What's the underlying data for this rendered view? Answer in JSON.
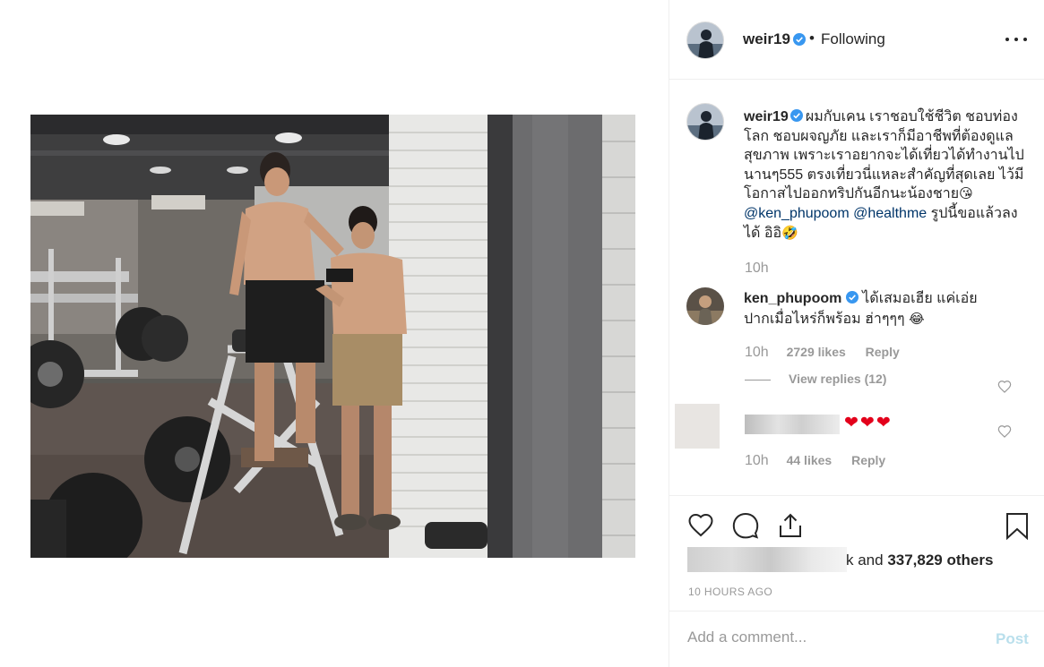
{
  "post": {
    "username": "weir19",
    "follow_status": "Following",
    "separator": "•",
    "photo_alt": ""
  },
  "caption": {
    "username": "weir19",
    "text_part1": "ผมกับเคน เราชอบใช้ชีวิต ชอบท่องโลก ชอบผจญภัย และเราก็มีอาชีพที่ต้องดูแลสุขภาพ เพราะเราอยากจะได้เที่ยวได้ทำงานไปนานๆ555 ตรงเที่ยวนี่แหละสำคัญที่สุดเลย ไว้มีโอกาสไปออกทริปกันอีกนะน้องชาย",
    "emoji1": "😘",
    "mention1": "@ken_phupoom",
    "mention2": "@healthme",
    "text_part2": "รูปนี้ขอแล้วลงได้ อิอิ",
    "emoji2": "🤣",
    "time": "10h"
  },
  "comments": [
    {
      "username": "ken_phupoom",
      "text": "ได้เสมอเฮีย แค่เอ่ยปากเมื่อไหร่ก็พร้อม ฮ่าๆๆๆ",
      "emoji": "😂",
      "time": "10h",
      "likes": "2729 likes",
      "reply_label": "Reply",
      "view_replies": "View replies (12)"
    },
    {
      "text": "❤❤❤",
      "time": "10h",
      "likes": "44 likes",
      "reply_label": "Reply"
    }
  ],
  "likes_summary": {
    "prefix": "k and ",
    "count": "337,829 others"
  },
  "timestamp": "10 HOURS AGO",
  "comment_box": {
    "placeholder": "Add a comment...",
    "post_label": "Post"
  },
  "colors": {
    "link": "#003569",
    "verified": "#3897f0",
    "muted": "#999999",
    "post_disabled": "#b9dfec",
    "heart_red": "#e3001b"
  },
  "icons": [
    "verified-badge-icon",
    "more-options-icon",
    "heart-icon",
    "comment-icon",
    "share-icon",
    "bookmark-icon"
  ]
}
